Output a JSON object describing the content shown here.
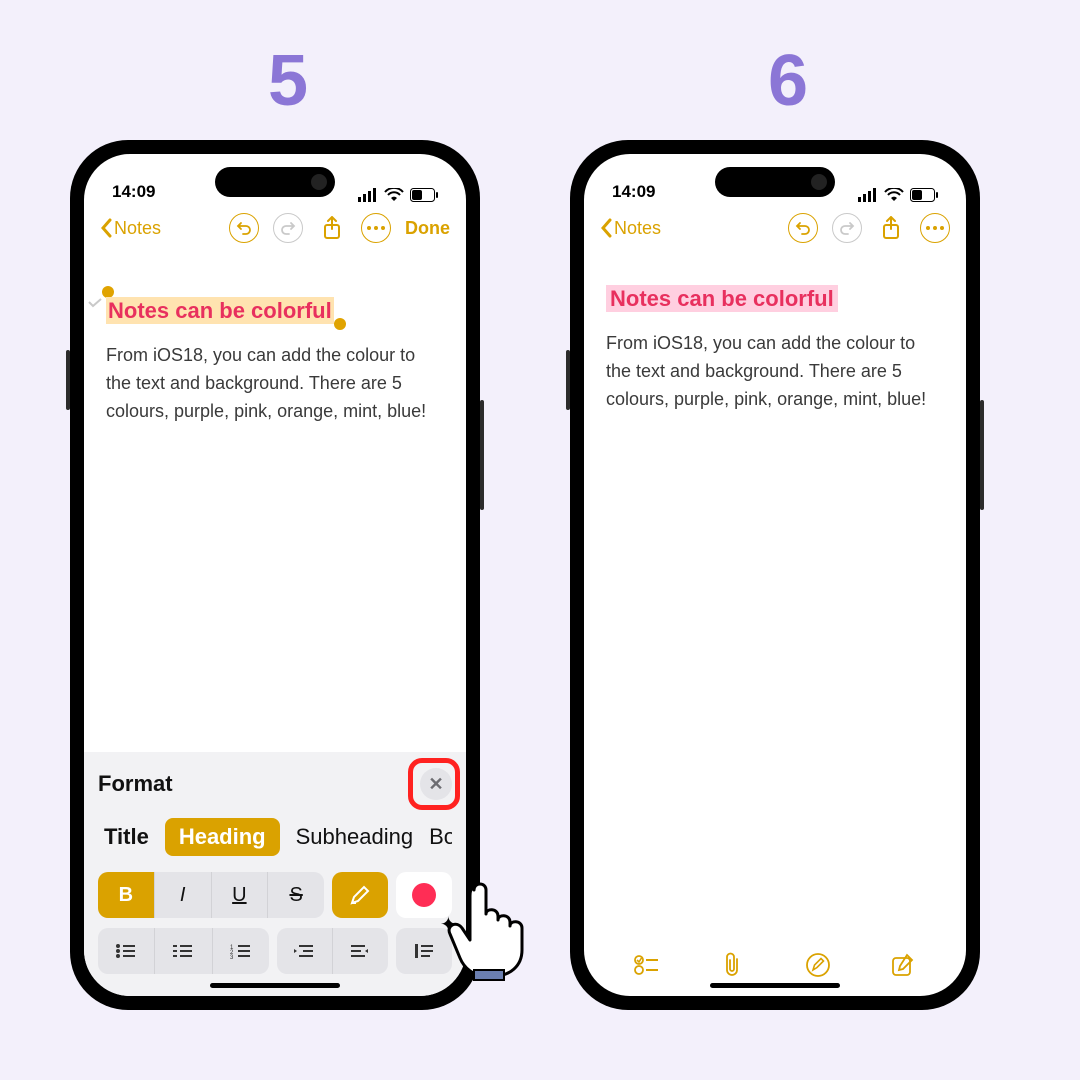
{
  "steps": {
    "left": "5",
    "right": "6"
  },
  "status": {
    "time": "14:09"
  },
  "nav": {
    "back_label": "Notes",
    "done_label": "Done"
  },
  "note": {
    "title": "Notes can be colorful",
    "body": "From iOS18, you can add the colour to the text and background. There are 5 colours, purple, pink, orange, mint, blue!"
  },
  "format": {
    "title": "Format",
    "styles": {
      "title": "Title",
      "heading": "Heading",
      "subheading": "Subheading",
      "body": "Body"
    },
    "inline": {
      "bold": "B",
      "italic": "I",
      "underline": "U",
      "strike": "S"
    },
    "selected_color": "#ff2d55"
  },
  "colors": {
    "accent": "#daa200",
    "title_text": "#e8305e",
    "step_number": "#8b76d6",
    "highlight_red": "#ff2220"
  }
}
